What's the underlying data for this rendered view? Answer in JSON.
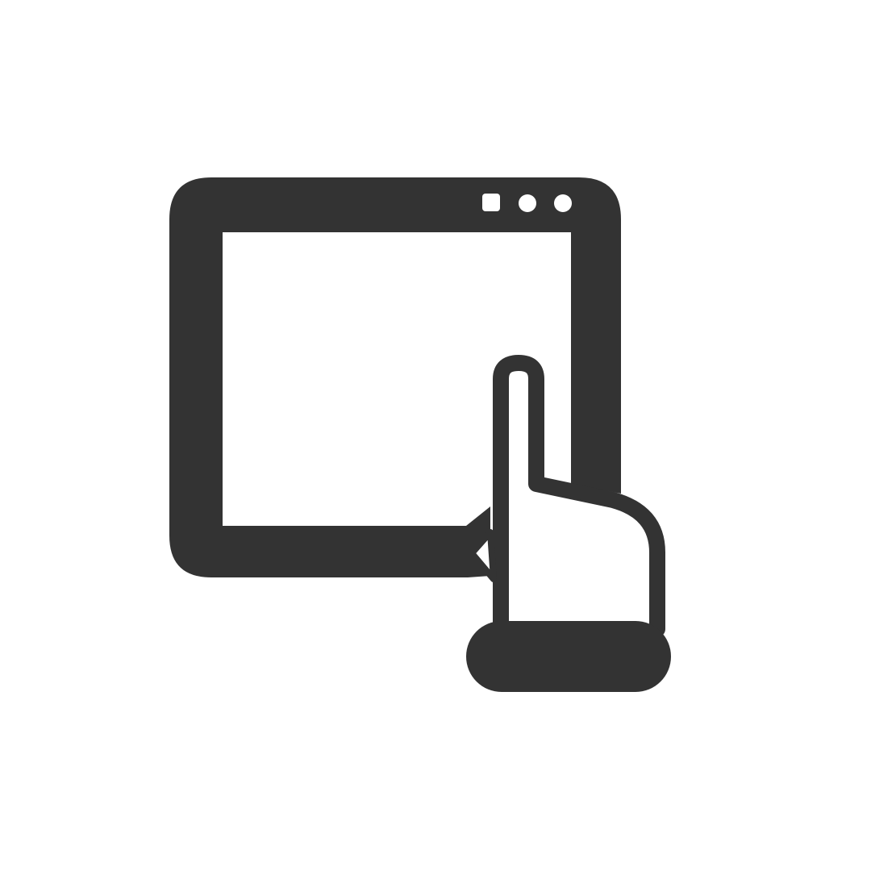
{
  "icon": {
    "name": "touch-screen-icon",
    "color": "#333333",
    "background": "#ffffff"
  }
}
